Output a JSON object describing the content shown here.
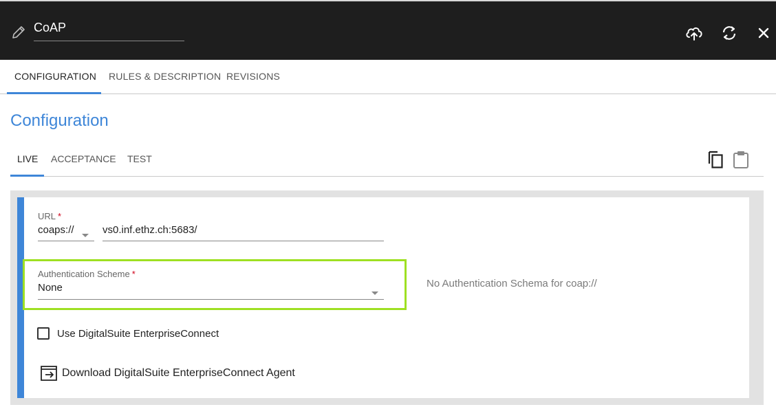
{
  "header": {
    "title": "CoAP",
    "icons": [
      "pencil-icon",
      "cloud-upload-icon",
      "refresh-icon",
      "close-icon"
    ]
  },
  "main_tabs": [
    {
      "label": "CONFIGURATION",
      "active": true
    },
    {
      "label": "RULES & DESCRIPTION",
      "active": false
    },
    {
      "label": "REVISIONS",
      "active": false
    }
  ],
  "section": {
    "title": "Configuration"
  },
  "env_tabs": [
    {
      "label": "LIVE",
      "active": true
    },
    {
      "label": "ACCEPTANCE",
      "active": false
    },
    {
      "label": "TEST",
      "active": false
    }
  ],
  "toolbar_icons": [
    "copy-icon",
    "paste-icon"
  ],
  "form": {
    "url": {
      "label": "URL",
      "required_mark": "*",
      "scheme": "coaps://",
      "host": "vs0.inf.ethz.ch:5683/"
    },
    "auth": {
      "label": "Authentication Scheme",
      "required_mark": "*",
      "value": "None",
      "note": "No Authentication Schema for coap://"
    },
    "enterprise_connect": {
      "label": "Use DigitalSuite EnterpriseConnect",
      "checked": false
    },
    "download": {
      "label": "Download DigitalSuite EnterpriseConnect Agent"
    }
  },
  "colors": {
    "accent": "#3e86d8",
    "topbar": "#1e1e1e",
    "highlight": "#9ee022",
    "required": "#d0021b"
  }
}
